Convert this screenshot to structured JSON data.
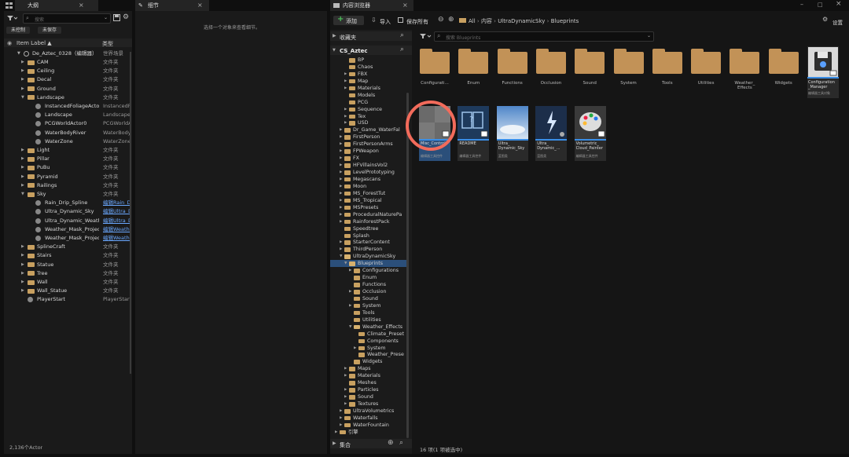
{
  "outline": {
    "tab": "大纲",
    "search_placeholder": "搜索",
    "btn_unsaved_ctrl": "未控制",
    "btn_unsaved": "未保存",
    "col_label": "Item Label ▲",
    "col_type": "类型",
    "root": {
      "label": "De_Aztec_0328（编辑器）",
      "type": "世界场景"
    },
    "rows": [
      {
        "label": "CAM",
        "type": "文件夹",
        "indent": 1,
        "kind": "folder"
      },
      {
        "label": "Ceiling",
        "type": "文件夹",
        "indent": 1,
        "kind": "folder"
      },
      {
        "label": "Decal",
        "type": "文件夹",
        "indent": 1,
        "kind": "folder"
      },
      {
        "label": "Ground",
        "type": "文件夹",
        "indent": 1,
        "kind": "folder"
      },
      {
        "label": "Landscape",
        "type": "文件夹",
        "indent": 1,
        "kind": "folder-open"
      },
      {
        "label": "InstancedFoliageActor",
        "type": "InstancedFo",
        "indent": 2,
        "kind": "actor"
      },
      {
        "label": "Landscape",
        "type": "Landscape",
        "indent": 2,
        "kind": "actor"
      },
      {
        "label": "PCGWorldActor0",
        "type": "PCGWorldAc",
        "indent": 2,
        "kind": "actor"
      },
      {
        "label": "WaterBodyRiver",
        "type": "WaterBodyR",
        "indent": 2,
        "kind": "actor"
      },
      {
        "label": "WaterZone",
        "type": "WaterZone",
        "indent": 2,
        "kind": "actor"
      },
      {
        "label": "Light",
        "type": "文件夹",
        "indent": 1,
        "kind": "folder"
      },
      {
        "label": "Pillar",
        "type": "文件夹",
        "indent": 1,
        "kind": "folder"
      },
      {
        "label": "PuBu",
        "type": "文件夹",
        "indent": 1,
        "kind": "folder"
      },
      {
        "label": "Pyramid",
        "type": "文件夹",
        "indent": 1,
        "kind": "folder"
      },
      {
        "label": "Railings",
        "type": "文件夹",
        "indent": 1,
        "kind": "folder"
      },
      {
        "label": "Sky",
        "type": "文件夹",
        "indent": 1,
        "kind": "folder-open"
      },
      {
        "label": "Rain_Drip_Spline",
        "type": "编辑Rain_D",
        "indent": 2,
        "kind": "actor",
        "link": true
      },
      {
        "label": "Ultra_Dynamic_Sky",
        "type": "编辑Ultra_D",
        "indent": 2,
        "kind": "actor",
        "link": true
      },
      {
        "label": "Ultra_Dynamic_Weath",
        "type": "编辑Ultra_D",
        "indent": 2,
        "kind": "actor",
        "link": true
      },
      {
        "label": "Weather_Mask_Projec",
        "type": "编辑Weathe",
        "indent": 2,
        "kind": "actor",
        "link": true
      },
      {
        "label": "Weather_Mask_Projec",
        "type": "编辑Weathe",
        "indent": 2,
        "kind": "actor",
        "link": true
      },
      {
        "label": "SplineCraft",
        "type": "文件夹",
        "indent": 1,
        "kind": "folder"
      },
      {
        "label": "Stairs",
        "type": "文件夹",
        "indent": 1,
        "kind": "folder"
      },
      {
        "label": "Statue",
        "type": "文件夹",
        "indent": 1,
        "kind": "folder"
      },
      {
        "label": "Tree",
        "type": "文件夹",
        "indent": 1,
        "kind": "folder"
      },
      {
        "label": "Wall",
        "type": "文件夹",
        "indent": 1,
        "kind": "folder"
      },
      {
        "label": "Wall_Statue",
        "type": "文件夹",
        "indent": 1,
        "kind": "folder"
      },
      {
        "label": "PlayerStart",
        "type": "PlayerStart",
        "indent": 1,
        "kind": "actor"
      }
    ],
    "footer": "2,136个Actor"
  },
  "details": {
    "tab": "细节",
    "empty_hint": "选择一个对象来查看细节。"
  },
  "content": {
    "tab": "内容浏览器",
    "add_label": "添加",
    "import_label": "导入",
    "save_all_label": "保存所有",
    "breadcrumb": [
      "All",
      "内容",
      "UltraDynamicSky",
      "Blueprints"
    ],
    "settings_label": "设置",
    "favorites_label": "收藏夹",
    "project_label": "CS_Aztec",
    "search_placeholder": "搜索 Blueprints",
    "collections_label": "集合",
    "status": "16 项(1 项被选中)",
    "tree": [
      {
        "label": "BP",
        "indent": 3
      },
      {
        "label": "Chaos",
        "indent": 3
      },
      {
        "label": "FBX",
        "indent": 3,
        "arrow": true
      },
      {
        "label": "Map",
        "indent": 3,
        "arrow": true
      },
      {
        "label": "Materials",
        "indent": 3,
        "arrow": true
      },
      {
        "label": "Models",
        "indent": 3
      },
      {
        "label": "PCG",
        "indent": 3
      },
      {
        "label": "Sequence",
        "indent": 3,
        "arrow": true
      },
      {
        "label": "Tex",
        "indent": 3,
        "arrow": true
      },
      {
        "label": "USD",
        "indent": 3,
        "arrow": true
      },
      {
        "label": "Dr_Game_WaterFal",
        "indent": 2,
        "arrow": true
      },
      {
        "label": "FirstPerson",
        "indent": 2,
        "arrow": true
      },
      {
        "label": "FirstPersonArms",
        "indent": 2,
        "arrow": true
      },
      {
        "label": "FPWeapon",
        "indent": 2,
        "arrow": true
      },
      {
        "label": "FX",
        "indent": 2,
        "arrow": true
      },
      {
        "label": "HFVillainsVol2",
        "indent": 2,
        "arrow": true
      },
      {
        "label": "LevelPrototyping",
        "indent": 2,
        "arrow": true
      },
      {
        "label": "Megascans",
        "indent": 2,
        "arrow": true
      },
      {
        "label": "Moon",
        "indent": 2,
        "arrow": true
      },
      {
        "label": "MS_ForestTut",
        "indent": 2,
        "arrow": true
      },
      {
        "label": "MS_Tropical",
        "indent": 2,
        "arrow": true
      },
      {
        "label": "MSPresets",
        "indent": 2,
        "arrow": true
      },
      {
        "label": "ProceduralNaturePa",
        "indent": 2,
        "arrow": true
      },
      {
        "label": "RainforestPack",
        "indent": 2,
        "arrow": true
      },
      {
        "label": "Speedtree",
        "indent": 2
      },
      {
        "label": "Splash",
        "indent": 2
      },
      {
        "label": "StarterContent",
        "indent": 2,
        "arrow": true
      },
      {
        "label": "ThirdPerson",
        "indent": 2,
        "arrow": true
      },
      {
        "label": "UltraDynamicSky",
        "indent": 2,
        "open": true
      },
      {
        "label": "Blueprints",
        "indent": 3,
        "open": true,
        "selected": true
      },
      {
        "label": "Configurations",
        "indent": 4,
        "arrow": true
      },
      {
        "label": "Enum",
        "indent": 4
      },
      {
        "label": "Functions",
        "indent": 4
      },
      {
        "label": "Occlusion",
        "indent": 4,
        "arrow": true
      },
      {
        "label": "Sound",
        "indent": 4
      },
      {
        "label": "System",
        "indent": 4,
        "arrow": true
      },
      {
        "label": "Tools",
        "indent": 4
      },
      {
        "label": "Utilities",
        "indent": 4
      },
      {
        "label": "Weather_Effects",
        "indent": 4,
        "open": true
      },
      {
        "label": "Climate_Preset",
        "indent": 5
      },
      {
        "label": "Components",
        "indent": 5
      },
      {
        "label": "System",
        "indent": 5,
        "arrow": true
      },
      {
        "label": "Weather_Prese",
        "indent": 5
      },
      {
        "label": "Widgets",
        "indent": 4
      },
      {
        "label": "Maps",
        "indent": 3,
        "arrow": true
      },
      {
        "label": "Materials",
        "indent": 3,
        "arrow": true
      },
      {
        "label": "Meshes",
        "indent": 3
      },
      {
        "label": "Particles",
        "indent": 3,
        "arrow": true
      },
      {
        "label": "Sound",
        "indent": 3,
        "arrow": true
      },
      {
        "label": "Textures",
        "indent": 3,
        "arrow": true
      },
      {
        "label": "UltraVolumetrics",
        "indent": 2,
        "arrow": true
      },
      {
        "label": "Waterfalls",
        "indent": 2,
        "arrow": true
      },
      {
        "label": "WaterFountain",
        "indent": 2,
        "arrow": true
      },
      {
        "label": "引擎",
        "indent": 1,
        "arrow": true
      }
    ],
    "folders": [
      "Configurati...",
      "Enum",
      "Functions",
      "Occlusion",
      "Sound",
      "System",
      "Tools",
      "Utilities",
      "Weather_ Effects",
      "Widgets"
    ],
    "config_asset": {
      "name": "Configuration _Manager",
      "type": "编辑器工具对象"
    },
    "assets": [
      {
        "name": "Misc_Controls",
        "type": "编辑器工具控件",
        "kind": "misc",
        "selected": true
      },
      {
        "name": "README",
        "type": "编辑器工具控件",
        "kind": "readme"
      },
      {
        "name": "Ultra_ Dynamic_Sky",
        "type": "蓝图类",
        "kind": "sky"
      },
      {
        "name": "Ultra_ Dynamic_...",
        "type": "蓝图类",
        "kind": "storm"
      },
      {
        "name": "Volumetric_ Cloud_Painter",
        "type": "编辑器工具控件",
        "kind": "palette"
      }
    ]
  },
  "colors": {
    "accent": "#3a8ee6",
    "folder": "#c29257",
    "highlight_ring": "#f26b5b",
    "link": "#6aa8ff"
  }
}
